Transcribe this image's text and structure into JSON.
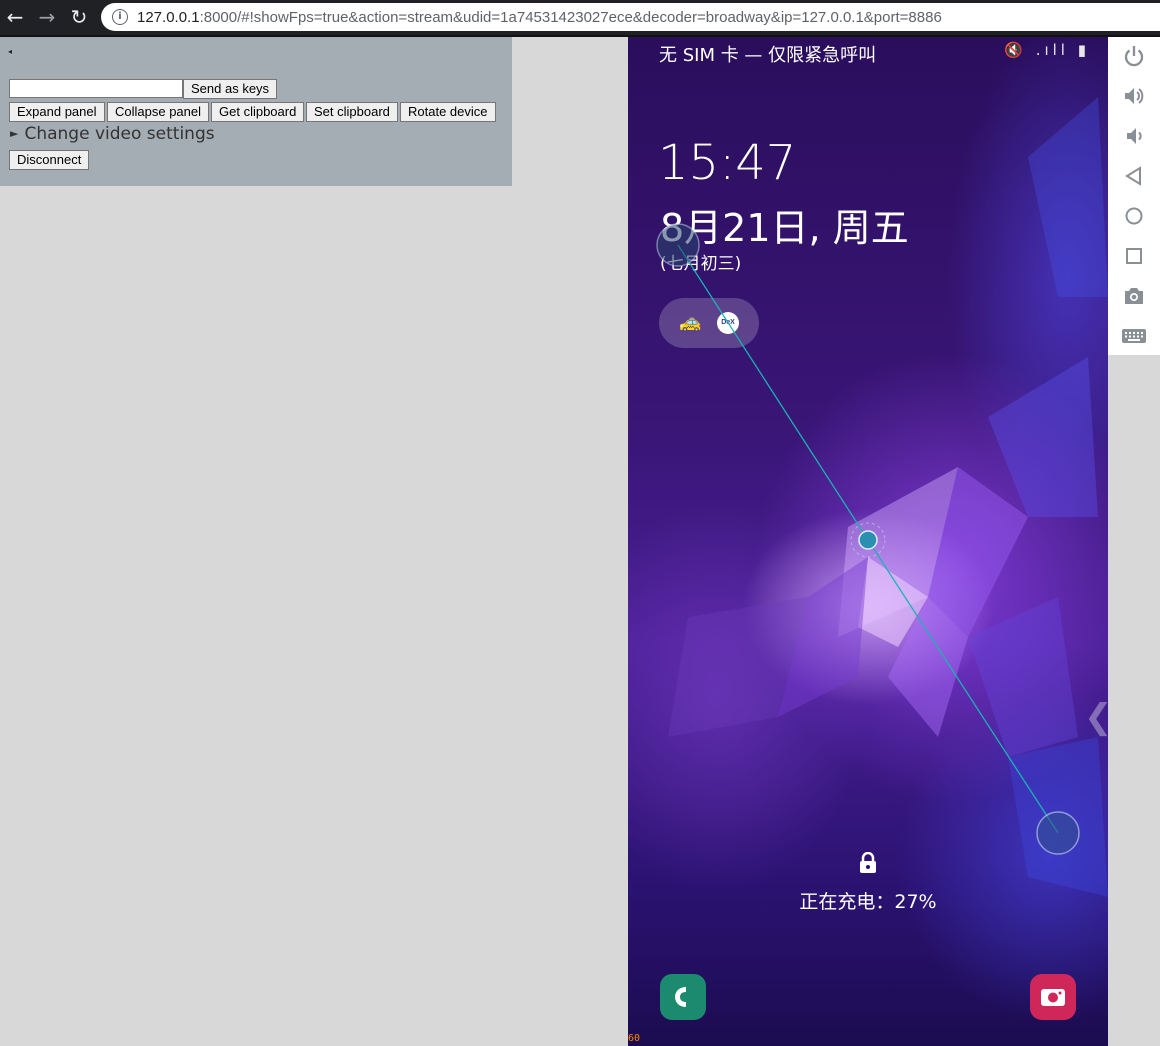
{
  "browser": {
    "url_host": "127.0.0.1",
    "url_rest": ":8000/#!showFps=true&action=stream&udid=1a74531423027ece&decoder=broadway&ip=127.0.0.1&port=8886",
    "back_icon": "arrow-left-icon",
    "forward_icon": "arrow-right-icon",
    "reload_icon": "reload-icon",
    "info_icon": "info-icon"
  },
  "panel": {
    "toggle_glyph": "◂",
    "keys_input_value": "",
    "send_keys_label": "Send as keys",
    "expand_label": "Expand panel",
    "collapse_label": "Collapse panel",
    "get_clipboard_label": "Get clipboard",
    "set_clipboard_label": "Set clipboard",
    "rotate_label": "Rotate device",
    "video_settings_arrow": "►",
    "video_settings_label": "Change video settings",
    "disconnect_label": "Disconnect"
  },
  "device": {
    "status_left": "无 SIM 卡 — 仅限紧急呼叫",
    "status_right": "🔇 .ıll ▮",
    "clock": "15:47",
    "date": "8月21日, 周五",
    "lunar": "(七月初三)",
    "dex_label": "DeX",
    "taxi_glyph": "🚕",
    "charging": "正在充电：27%",
    "fps": "60",
    "edge_chevron": "❮",
    "colors": {
      "touch_line": "#18b4b4",
      "phone_icon_bg": "#1b8a6e",
      "camera_icon_bg": "#d0275a"
    }
  },
  "side_controls": [
    {
      "name": "power-icon"
    },
    {
      "name": "volume-up-icon"
    },
    {
      "name": "volume-down-icon"
    },
    {
      "name": "back-triangle-icon"
    },
    {
      "name": "home-circle-icon"
    },
    {
      "name": "overview-square-icon"
    },
    {
      "name": "camera-screenshot-icon"
    },
    {
      "name": "keyboard-icon"
    }
  ]
}
